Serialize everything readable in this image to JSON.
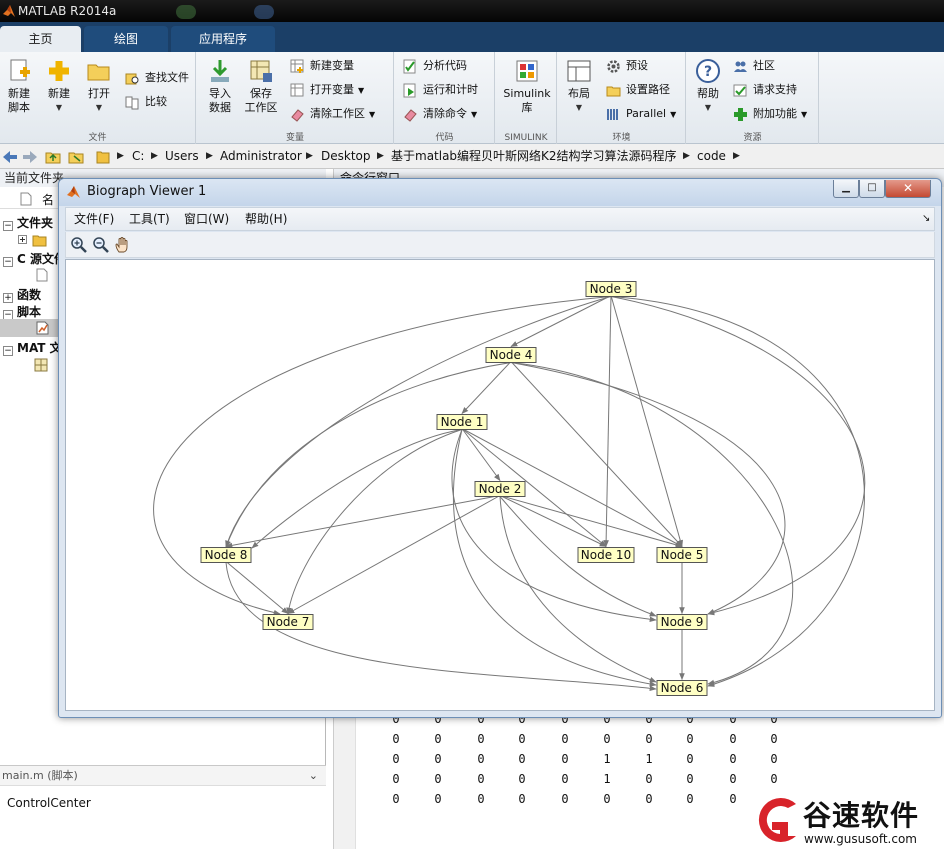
{
  "window_title": "MATLAB R2014a",
  "ribbon_tabs": [
    {
      "label": "主页"
    },
    {
      "label": "绘图"
    },
    {
      "label": "应用程序"
    }
  ],
  "ribbon": {
    "file": {
      "section": "文件",
      "new_script": "新建\n脚本",
      "new": "新建",
      "open": "打开",
      "find_files": "查找文件",
      "compare": "比较"
    },
    "variable": {
      "section": "变量",
      "import_data": "导入\n数据",
      "save_workspace": "保存\n工作区",
      "new_variable": "新建变量",
      "open_variable": "打开变量",
      "clear_workspace": "清除工作区"
    },
    "code": {
      "section": "代码",
      "analyze_code": "分析代码",
      "run_and_time": "运行和计时",
      "clear_commands": "清除命令"
    },
    "simulink": {
      "section": "SIMULINK",
      "library": "Simulink\n库"
    },
    "environment": {
      "section": "环境",
      "layout": "布局",
      "preferences": "预设",
      "set_path": "设置路径",
      "parallel": "Parallel"
    },
    "resources": {
      "section": "资源",
      "help": "帮助",
      "community": "社区",
      "request_support": "请求支持",
      "add_ons": "附加功能"
    }
  },
  "address": {
    "crumbs": [
      "C:",
      "Users",
      "Administrator",
      "Desktop",
      "基于matlab编程贝叶斯网络K2结构学习算法源码程序",
      "code"
    ]
  },
  "current_folder": {
    "title": "当前文件夹",
    "column_name": "名",
    "groups": [
      "文件夹",
      "C 源文件",
      "函数",
      "脚本",
      "MAT 文"
    ],
    "details_title": "main.m (脚本)",
    "details_content": "ControlCenter"
  },
  "command_window": {
    "title": "命令行窗口",
    "matrix_rows": [
      [
        "0",
        "0",
        "0",
        "0",
        "0",
        "0",
        "0",
        "0",
        "0",
        "0"
      ],
      [
        "0",
        "0",
        "0",
        "0",
        "0",
        "0",
        "0",
        "0",
        "0",
        "0"
      ],
      [
        "0",
        "0",
        "0",
        "0",
        "0",
        "1",
        "1",
        "0",
        "0",
        "0"
      ],
      [
        "0",
        "0",
        "0",
        "0",
        "0",
        "1",
        "0",
        "0",
        "0",
        "0"
      ],
      [
        "0",
        "0",
        "0",
        "0",
        "0",
        "0",
        "0",
        "0",
        "0",
        "0"
      ]
    ]
  },
  "biograph": {
    "title": "Biograph Viewer 1",
    "menu": [
      "文件(F)",
      "工具(T)",
      "窗口(W)",
      "帮助(H)"
    ],
    "toolbar_icons": [
      "zoom-in-icon",
      "zoom-out-icon",
      "pan-hand-icon"
    ],
    "nodes": [
      {
        "id": "3",
        "label": "Node 3"
      },
      {
        "id": "4",
        "label": "Node 4"
      },
      {
        "id": "1",
        "label": "Node 1"
      },
      {
        "id": "2",
        "label": "Node 2"
      },
      {
        "id": "8",
        "label": "Node 8"
      },
      {
        "id": "10",
        "label": "Node 10"
      },
      {
        "id": "5",
        "label": "Node 5"
      },
      {
        "id": "7",
        "label": "Node 7"
      },
      {
        "id": "9",
        "label": "Node 9"
      },
      {
        "id": "6",
        "label": "Node 6"
      }
    ],
    "edges": [
      [
        "3",
        "4"
      ],
      [
        "3",
        "10"
      ],
      [
        "3",
        "5"
      ],
      [
        "3",
        "8"
      ],
      [
        "3",
        "7"
      ],
      [
        "3",
        "9"
      ],
      [
        "3",
        "6"
      ],
      [
        "4",
        "1"
      ],
      [
        "4",
        "8"
      ],
      [
        "4",
        "5"
      ],
      [
        "4",
        "9"
      ],
      [
        "4",
        "6"
      ],
      [
        "1",
        "2"
      ],
      [
        "1",
        "8"
      ],
      [
        "1",
        "7"
      ],
      [
        "1",
        "10"
      ],
      [
        "1",
        "5"
      ],
      [
        "1",
        "9"
      ],
      [
        "1",
        "6"
      ],
      [
        "2",
        "8"
      ],
      [
        "2",
        "7"
      ],
      [
        "2",
        "10"
      ],
      [
        "2",
        "5"
      ],
      [
        "2",
        "9"
      ],
      [
        "2",
        "6"
      ],
      [
        "5",
        "9"
      ],
      [
        "8",
        "7"
      ],
      [
        "8",
        "6"
      ],
      [
        "9",
        "6"
      ]
    ]
  },
  "watermark": {
    "brand": "谷速软件",
    "url": "www.gususoft.com",
    "color": "#d8232a"
  }
}
